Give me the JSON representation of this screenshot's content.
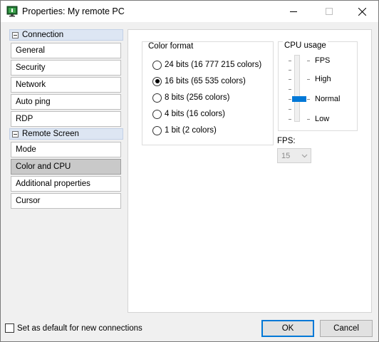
{
  "window": {
    "title": "Properties: My remote PC",
    "icon": "monitor-app-icon",
    "controls": [
      "minimize",
      "maximize",
      "close"
    ]
  },
  "nav": {
    "groups": [
      {
        "label": "Connection",
        "items": [
          "General",
          "Security",
          "Network",
          "Auto ping",
          "RDP"
        ]
      },
      {
        "label": "Remote Screen",
        "items": [
          "Mode",
          "Color and CPU",
          "Additional properties",
          "Cursor"
        ]
      }
    ],
    "selected": "Color and CPU"
  },
  "color_format": {
    "title": "Color format",
    "options": [
      {
        "label": "24 bits (16 777 215 colors)",
        "checked": false
      },
      {
        "label": "16 bits (65 535 colors)",
        "checked": true
      },
      {
        "label": "8 bits (256 colors)",
        "checked": false
      },
      {
        "label": "4 bits (16 colors)",
        "checked": false
      },
      {
        "label": "1 bit (2 colors)",
        "checked": false
      }
    ]
  },
  "cpu_usage": {
    "title": "CPU usage",
    "levels": [
      "FPS",
      "High",
      "Normal",
      "Low"
    ],
    "selected": "Normal",
    "accent": "#0078d7"
  },
  "fps": {
    "label": "FPS:",
    "value": "15",
    "disabled": true
  },
  "footer": {
    "default_checkbox_label": "Set as default for new connections",
    "default_checked": false,
    "ok_label": "OK",
    "cancel_label": "Cancel"
  }
}
